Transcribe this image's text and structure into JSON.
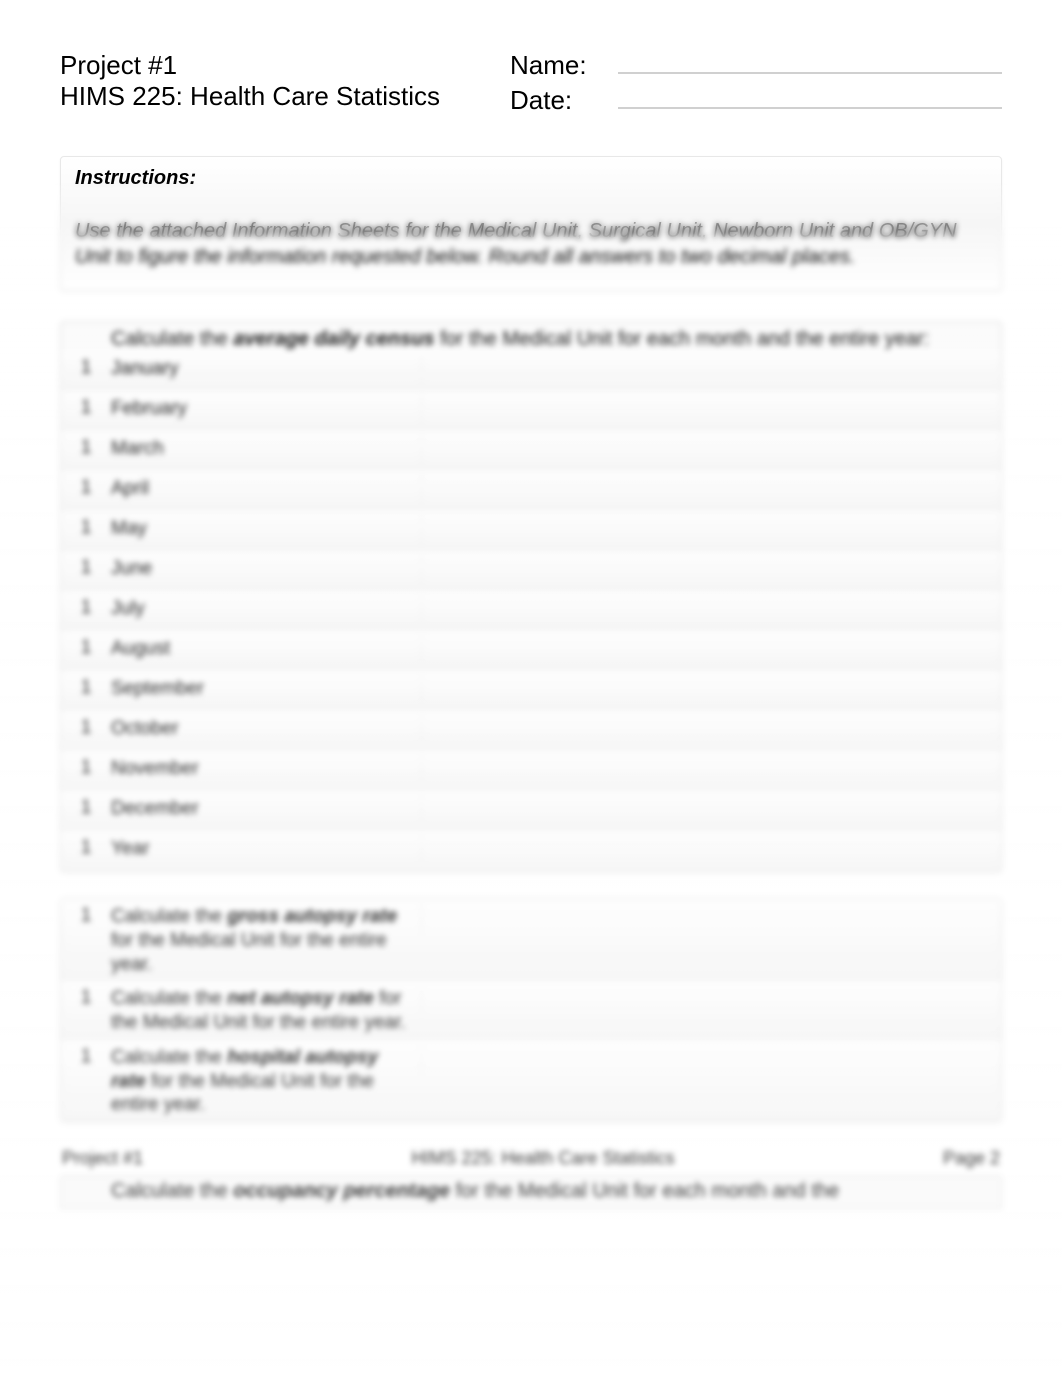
{
  "header": {
    "project_line": "Project #1",
    "course_line": "HIMS 225:  Health Care Statistics",
    "name_label": "Name:",
    "date_label": "Date:"
  },
  "instructions": {
    "title": "Instructions:",
    "body": "Use the attached Information Sheets for the Medical Unit, Surgical Unit, Newborn Unit and OB/GYN Unit to figure the information requested below.  Round all answers to two decimal places."
  },
  "section_adc": {
    "prompt_pre": "Calculate the ",
    "prompt_bold": "average daily census",
    "prompt_post": " for the Medical Unit for each month and the entire year:",
    "rows": [
      {
        "num": "1",
        "label": "January"
      },
      {
        "num": "1",
        "label": "February"
      },
      {
        "num": "1",
        "label": "March"
      },
      {
        "num": "1",
        "label": "April"
      },
      {
        "num": "1",
        "label": "May"
      },
      {
        "num": "1",
        "label": "June"
      },
      {
        "num": "1",
        "label": "July"
      },
      {
        "num": "1",
        "label": "August"
      },
      {
        "num": "1",
        "label": "September"
      },
      {
        "num": "1",
        "label": "October"
      },
      {
        "num": "1",
        "label": "November"
      },
      {
        "num": "1",
        "label": "December"
      },
      {
        "num": "1",
        "label": "Year"
      }
    ]
  },
  "section_rates": {
    "rows": [
      {
        "num": "1",
        "pre": "Calculate the ",
        "bold": "gross autopsy rate",
        "post": " for the Medical Unit for the entire year."
      },
      {
        "num": "1",
        "pre": "Calculate the ",
        "bold": "net autopsy rate",
        "post": " for  the Medical Unit for the entire year."
      },
      {
        "num": "1",
        "pre": "Calculate the ",
        "bold": "hospital autopsy rate",
        "post": " for the Medical Unit for the entire year."
      }
    ]
  },
  "footer": {
    "left": "Project #1",
    "center": "HIMS 225:  Health Care Statistics",
    "right": "Page 2"
  },
  "bottom_strip": {
    "pre": "Calculate the ",
    "bold": "occupancy percentage",
    "post": " for the Medical Unit for each month and the"
  }
}
